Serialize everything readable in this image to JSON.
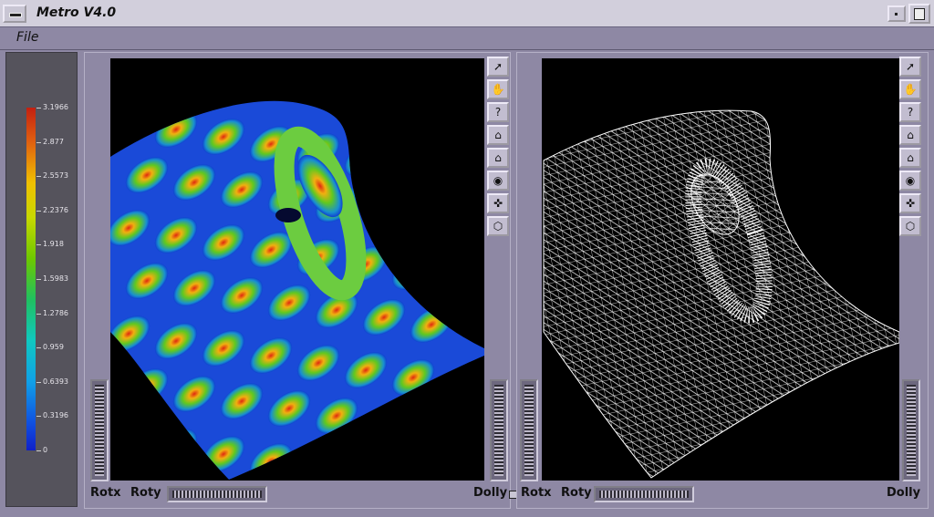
{
  "window": {
    "title": "Metro V4.0"
  },
  "menu": {
    "file_label": "File"
  },
  "legend": {
    "ticks": [
      "3.1966",
      "2.877",
      "2.5573",
      "2.2376",
      "1.918",
      "1.5983",
      "1.2786",
      "0.959",
      "0.6393",
      "0.3196",
      "0"
    ]
  },
  "viewers": [
    {
      "name": "shaded-viewer",
      "rotx": "Rotx",
      "roty": "Roty",
      "dolly": "Dolly"
    },
    {
      "name": "wireframe-viewer",
      "rotx": "Rotx",
      "roty": "Roty",
      "dolly": "Dolly"
    }
  ],
  "toolbar_icons": [
    "pointer-icon",
    "hand-icon",
    "help-icon",
    "home-icon",
    "set-home-icon",
    "eye-icon",
    "crosshair-icon",
    "perspective-box-icon"
  ],
  "toolbar_glyphs": [
    "➚",
    "✋",
    "?",
    "⌂",
    "⌂",
    "◉",
    "✜",
    "⬡"
  ],
  "colors": {
    "panel": "#8e88a4",
    "titlebar": "#d2cfdc",
    "viewport": "#000000"
  }
}
